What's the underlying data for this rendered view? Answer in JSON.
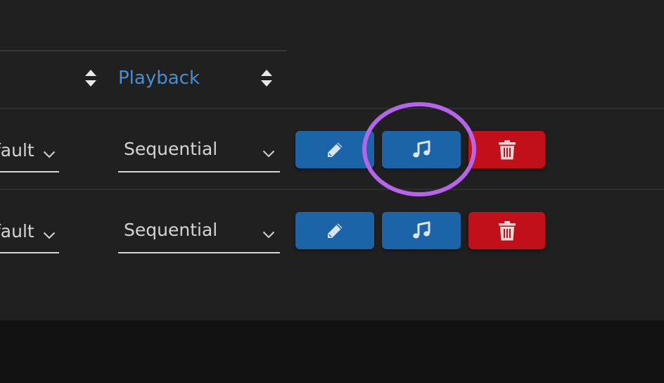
{
  "header": {
    "playback_label": "Playback"
  },
  "rows": [
    {
      "first_select_value": "fault",
      "playback_select_value": "Sequential",
      "actions": {
        "edit": "pencil-icon",
        "music": "music-note-icon",
        "delete": "trash-icon"
      }
    },
    {
      "first_select_value": "fault",
      "playback_select_value": "Sequential",
      "actions": {
        "edit": "pencil-icon",
        "music": "music-note-icon",
        "delete": "trash-icon"
      }
    }
  ],
  "colors": {
    "primary_button": "#1c64a8",
    "danger_button": "#c1101a",
    "link_header": "#4a8dd0",
    "highlight_circle": "#b565ea",
    "panel_bg": "#202020"
  }
}
